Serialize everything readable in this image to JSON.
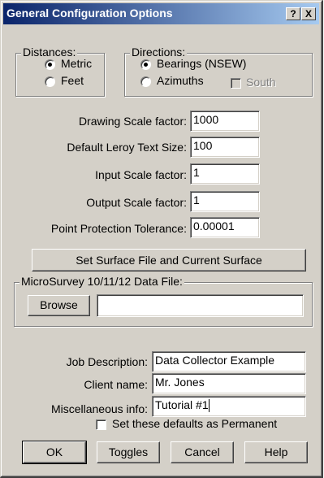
{
  "window": {
    "title": "General Configuration Options",
    "help_button": "?",
    "close_button": "X"
  },
  "distances": {
    "legend": "Distances:",
    "options": [
      {
        "label": "Metric",
        "selected": true
      },
      {
        "label": "Feet",
        "selected": false
      }
    ]
  },
  "directions": {
    "legend": "Directions:",
    "options": [
      {
        "label": "Bearings (NSEW)",
        "selected": true
      },
      {
        "label": "Azimuths",
        "selected": false
      }
    ],
    "south_label": "South",
    "south_checked": false,
    "south_enabled": false
  },
  "fields": {
    "drawing_scale": {
      "label": "Drawing Scale factor:",
      "value": "1000"
    },
    "leroy_text_size": {
      "label": "Default Leroy Text Size:",
      "value": "100"
    },
    "input_scale": {
      "label": "Input Scale factor:",
      "value": "1"
    },
    "output_scale": {
      "label": "Output Scale factor:",
      "value": "1"
    },
    "point_tolerance": {
      "label": "Point Protection Tolerance:",
      "value": "0.00001"
    }
  },
  "surface_button": "Set Surface File and Current Surface",
  "microsurvey": {
    "legend": "MicroSurvey 10/11/12 Data File:",
    "browse_label": "Browse",
    "file_value": ""
  },
  "job": {
    "description": {
      "label": "Job Description:",
      "value": "Data Collector Example"
    },
    "client": {
      "label": "Client name:",
      "value": "Mr. Jones"
    },
    "misc": {
      "label": "Miscellaneous info:",
      "value": "Tutorial #1"
    }
  },
  "permanent": {
    "label": "Set these defaults as Permanent",
    "checked": false
  },
  "buttons": {
    "ok": "OK",
    "toggles": "Toggles",
    "cancel": "Cancel",
    "help": "Help"
  }
}
